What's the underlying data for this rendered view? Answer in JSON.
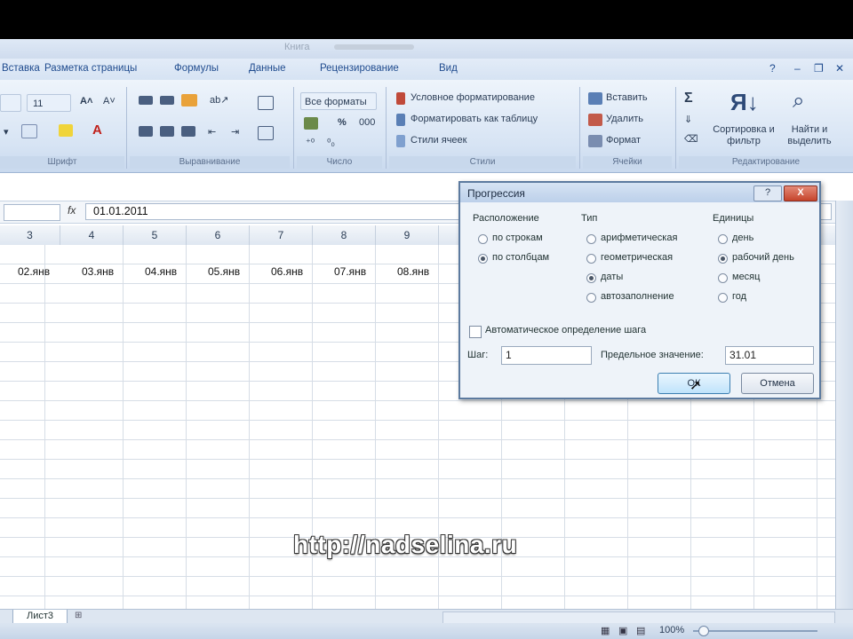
{
  "window": {
    "title": "Книга"
  },
  "menu": {
    "tabs": [
      "Вставка",
      "Разметка страницы",
      "Формулы",
      "Данные",
      "Рецензирование",
      "Вид"
    ]
  },
  "ribbon": {
    "font_size": "11",
    "number_format": "Все форматы",
    "percent": "%",
    "thousands": "000",
    "styles": {
      "conditional": "Условное форматирование",
      "as_table": "Форматировать как таблицу",
      "cell_styles": "Стили ячеек"
    },
    "cells": {
      "insert": "Вставить",
      "delete": "Удалить",
      "format": "Формат"
    },
    "editing": {
      "sort": "Сортировка и фильтр",
      "find": "Найти и выделить"
    },
    "groups": {
      "font": "Шрифт",
      "alignment": "Выравнивание",
      "number": "Число",
      "styles": "Стили",
      "cells": "Ячейки",
      "editing": "Редактирование"
    }
  },
  "formula_bar": {
    "fx": "fx",
    "value": "01.01.2011"
  },
  "grid": {
    "columns": [
      "3",
      "4",
      "5",
      "6",
      "7",
      "8",
      "9"
    ],
    "row_values": [
      "02.янв",
      "03.янв",
      "04.янв",
      "05.янв",
      "06.янв",
      "07.янв",
      "08.янв"
    ]
  },
  "sheet_tab": "Лист3",
  "zoom": "100%",
  "dialog": {
    "title": "Прогрессия",
    "help": "?",
    "close": "X",
    "placement": {
      "heading": "Расположение",
      "options": [
        "по строкам",
        "по столбцам"
      ],
      "selected": 1
    },
    "type": {
      "heading": "Тип",
      "options": [
        "арифметическая",
        "геометрическая",
        "даты",
        "автозаполнение"
      ],
      "selected": 2
    },
    "units": {
      "heading": "Единицы",
      "options": [
        "день",
        "рабочий день",
        "месяц",
        "год"
      ],
      "selected": 1
    },
    "auto_step": "Автоматическое определение шага",
    "step_label": "Шаг:",
    "step_value": "1",
    "limit_label": "Предельное значение:",
    "limit_value": "31.01",
    "ok": "ОК",
    "cancel": "Отмена"
  },
  "watermark": "http://nadselina.ru"
}
